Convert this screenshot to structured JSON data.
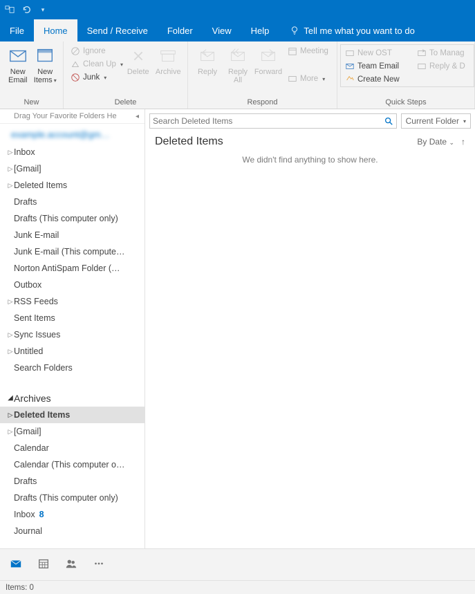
{
  "titlebar": {
    "qat": [
      "window-icon",
      "undo-icon",
      "customize-icon"
    ]
  },
  "tabs": {
    "file": "File",
    "items": [
      "Home",
      "Send / Receive",
      "Folder",
      "View",
      "Help"
    ],
    "active": 0,
    "tell_me": "Tell me what you want to do"
  },
  "ribbon": {
    "new": {
      "label": "New",
      "new_email": "New\nEmail",
      "new_items": "New\nItems"
    },
    "delete": {
      "label": "Delete",
      "ignore": "Ignore",
      "cleanup": "Clean Up",
      "junk": "Junk",
      "delete_btn": "Delete",
      "archive": "Archive"
    },
    "respond": {
      "label": "Respond",
      "reply": "Reply",
      "reply_all": "Reply\nAll",
      "forward": "Forward",
      "meeting": "Meeting",
      "more": "More"
    },
    "quicksteps": {
      "label": "Quick Steps",
      "new_ost": "New OST",
      "team_email": "Team Email",
      "create_new": "Create New",
      "to_manager": "To Manag",
      "reply_delete": "Reply & D"
    }
  },
  "folders": {
    "fav_header": "Drag Your Favorite Folders He",
    "account": "example.account@gm…",
    "tree1": [
      {
        "label": "Inbox",
        "expand": true
      },
      {
        "label": "[Gmail]",
        "expand": true
      },
      {
        "label": "Deleted Items",
        "expand": true
      },
      {
        "label": "Drafts"
      },
      {
        "label": "Drafts (This computer only)"
      },
      {
        "label": "Junk E-mail"
      },
      {
        "label": "Junk E-mail (This compute…"
      },
      {
        "label": "Norton AntiSpam Folder (…"
      },
      {
        "label": "Outbox"
      },
      {
        "label": "RSS Feeds",
        "expand": true
      },
      {
        "label": "Sent Items"
      },
      {
        "label": "Sync Issues",
        "expand": true
      },
      {
        "label": "Untitled",
        "expand": true
      },
      {
        "label": "Search Folders"
      }
    ],
    "section2": "Archives",
    "tree2": [
      {
        "label": "Deleted Items",
        "expand": true,
        "selected": true
      },
      {
        "label": "[Gmail]",
        "expand": true
      },
      {
        "label": "Calendar"
      },
      {
        "label": "Calendar (This computer o…"
      },
      {
        "label": "Drafts"
      },
      {
        "label": "Drafts (This computer only)"
      },
      {
        "label": "Inbox",
        "count": "8"
      },
      {
        "label": "Journal"
      }
    ]
  },
  "search": {
    "placeholder": "Search Deleted Items",
    "scope": "Current Folder"
  },
  "list": {
    "title": "Deleted Items",
    "sort": "By Date",
    "empty": "We didn't find anything to show here."
  },
  "status": {
    "items": "Items: 0"
  }
}
